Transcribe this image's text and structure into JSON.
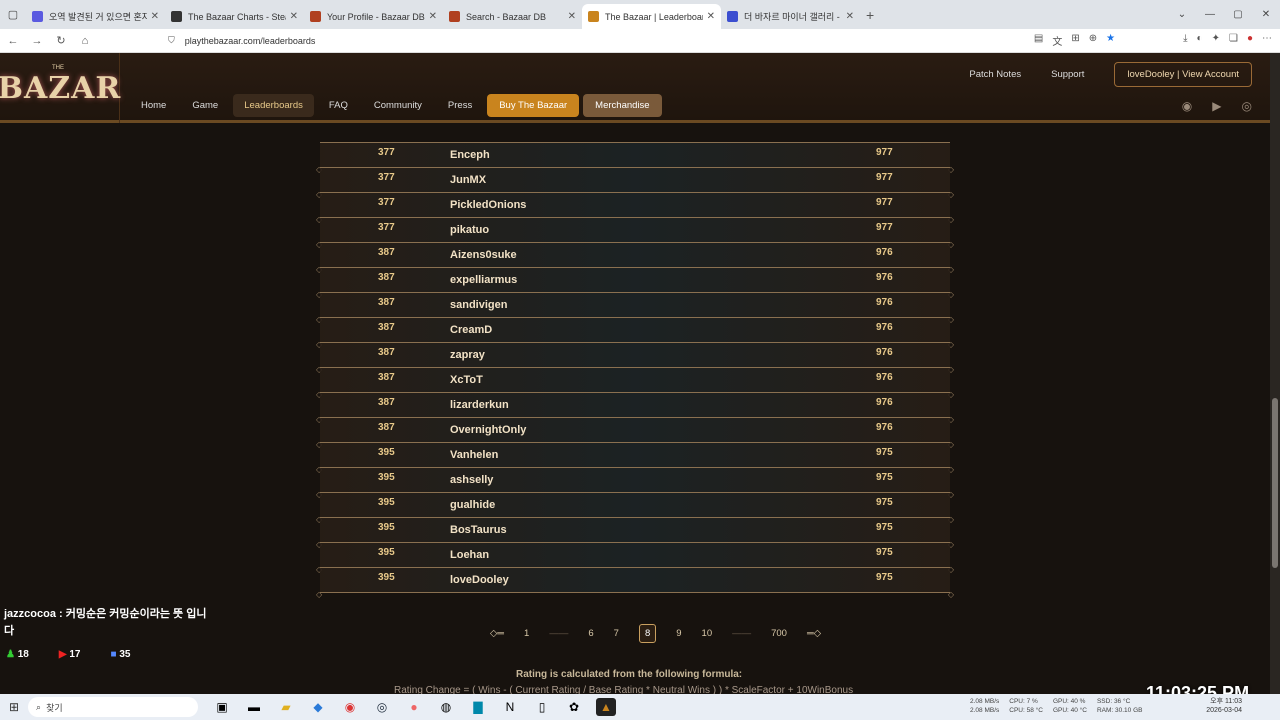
{
  "browser": {
    "tabs": [
      {
        "title": "오역 발견된 거 있으면 혼자인",
        "color": "#5a5ae0"
      },
      {
        "title": "The Bazaar Charts - SteamDB",
        "color": "#333333"
      },
      {
        "title": "Your Profile - Bazaar DB",
        "color": "#b04020"
      },
      {
        "title": "Search - Bazaar DB",
        "color": "#b04020"
      },
      {
        "title": "The Bazaar | Leaderboards",
        "color": "#c9841e",
        "active": true
      },
      {
        "title": "더 바자르 마이너 갤러리 - 커뮤",
        "color": "#3b4ed0"
      }
    ],
    "url": "playthebazaar.com/leaderboards"
  },
  "site": {
    "logo_small": "THE",
    "logo": "BAZAR",
    "nav": [
      "Home",
      "Game",
      "Leaderboards",
      "FAQ",
      "Community",
      "Press",
      "Buy The Bazaar",
      "Merchandise"
    ],
    "top": {
      "patch_notes": "Patch Notes",
      "support": "Support",
      "account": "loveDooley | View Account"
    }
  },
  "leaderboard": [
    {
      "rank": "377",
      "name": "Enceph",
      "score": "977"
    },
    {
      "rank": "377",
      "name": "JunMX",
      "score": "977"
    },
    {
      "rank": "377",
      "name": "PickledOnions",
      "score": "977"
    },
    {
      "rank": "377",
      "name": "pikatuo",
      "score": "977"
    },
    {
      "rank": "387",
      "name": "Aizens0suke",
      "score": "976"
    },
    {
      "rank": "387",
      "name": "expelliarmus",
      "score": "976"
    },
    {
      "rank": "387",
      "name": "sandivigen",
      "score": "976"
    },
    {
      "rank": "387",
      "name": "CreamD",
      "score": "976"
    },
    {
      "rank": "387",
      "name": "zapray",
      "score": "976"
    },
    {
      "rank": "387",
      "name": "XcToT",
      "score": "976"
    },
    {
      "rank": "387",
      "name": "lizarderkun",
      "score": "976"
    },
    {
      "rank": "387",
      "name": "OvernightOnly",
      "score": "976"
    },
    {
      "rank": "395",
      "name": "Vanhelen",
      "score": "975"
    },
    {
      "rank": "395",
      "name": "ashselly",
      "score": "975"
    },
    {
      "rank": "395",
      "name": "gualhide",
      "score": "975"
    },
    {
      "rank": "395",
      "name": "BosTaurus",
      "score": "975"
    },
    {
      "rank": "395",
      "name": "Loehan",
      "score": "975"
    },
    {
      "rank": "395",
      "name": "loveDooley",
      "score": "975"
    }
  ],
  "pager": {
    "first": "1",
    "p6": "6",
    "p7": "7",
    "current": "8",
    "p9": "9",
    "p10": "10",
    "last": "700"
  },
  "formula": {
    "title": "Rating is calculated from the following formula:",
    "text": "Rating Change = ( Wins - ( Current Rating / Base Rating * Neutral Wins ) ) * ScaleFactor + 10WinBonus"
  },
  "stream": {
    "chat": "jazzcocoa : 커밍순은 커밍순이라는 뜻 입니다",
    "stat1": "18",
    "stat2": "17",
    "stat3": "35"
  },
  "clock": "11:03:25 PM",
  "taskbar": {
    "search": "찾기",
    "net": "2.08 MB/s",
    "cpu": "CPU: 7 %",
    "gpu": "GPU: 40 %",
    "ssd": "SSD: 36 °C",
    "cpu_temp": "CPU: 58 °C",
    "gpu_temp": "GPU: 40 °C",
    "ram": "RAM: 30.10 GB",
    "time": "오후 11:03",
    "date": "2026-03-04"
  }
}
